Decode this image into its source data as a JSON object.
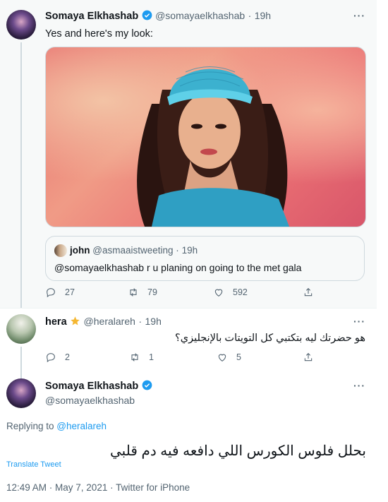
{
  "tweet1": {
    "name": "Somaya Elkhashab",
    "handle": "@somayaelkhashab",
    "time": "19h",
    "text": "Yes and here's my look:",
    "quote": {
      "name": "john",
      "handle": "@asmaaistweeting",
      "time": "19h",
      "text": "@somayaelkhashab r u planing on going to the met gala"
    },
    "counts": {
      "replies": "27",
      "retweets": "79",
      "likes": "592"
    }
  },
  "tweet2": {
    "name": "hera",
    "handle": "@heralareh",
    "time": "19h",
    "text": "هو حضرتك ليه بتكتبي كل التويتات بالإنجليزي؟",
    "counts": {
      "replies": "2",
      "retweets": "1",
      "likes": "5"
    }
  },
  "main": {
    "name": "Somaya Elkhashab",
    "handle": "@somayaelkhashab",
    "replying_prefix": "Replying to ",
    "replying_handle": "@heralareh",
    "text": "بحلل فلوس الكورس اللي دافعه فيه دم قلبي",
    "translate": "Translate Tweet",
    "meta": "12:49 AM · May 7, 2021 · Twitter for iPhone"
  },
  "ui": {
    "more": "···",
    "sep": "·"
  },
  "colors": {
    "accent": "#1d9bf0",
    "muted": "#536471",
    "shaded_bg": "#f7f9f9"
  }
}
